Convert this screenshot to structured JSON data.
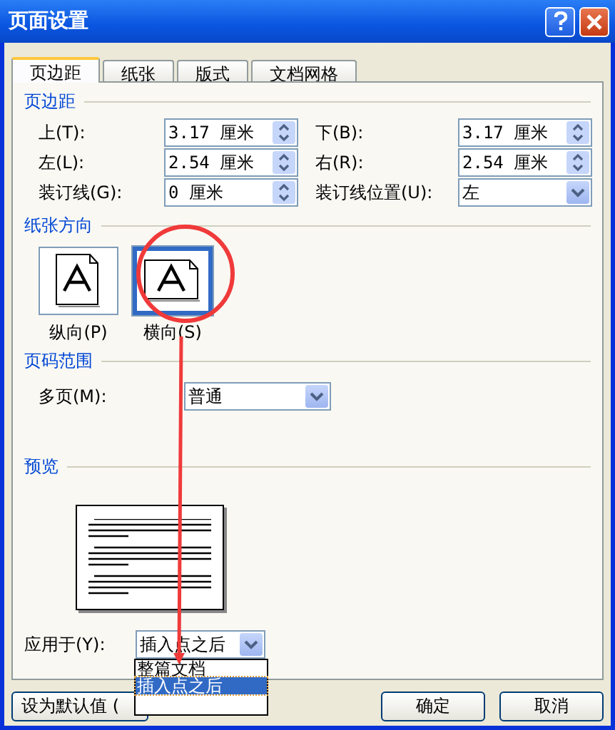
{
  "window": {
    "title": "页面设置"
  },
  "tabs": [
    {
      "label": "页边距",
      "selected": true
    },
    {
      "label": "纸张",
      "selected": false
    },
    {
      "label": "版式",
      "selected": false
    },
    {
      "label": "文档网格",
      "selected": false
    }
  ],
  "margins": {
    "title": "页边距",
    "fields": [
      {
        "label": "上(T):",
        "value": "3.17 厘米",
        "kind": "spinner"
      },
      {
        "label": "下(B):",
        "value": "3.17 厘米",
        "kind": "spinner"
      },
      {
        "label": "左(L):",
        "value": "2.54 厘米",
        "kind": "spinner"
      },
      {
        "label": "右(R):",
        "value": "2.54 厘米",
        "kind": "spinner"
      },
      {
        "label": "装订线(G):",
        "value": "0 厘米",
        "kind": "spinner"
      },
      {
        "label": "装订线位置(U):",
        "value": "左",
        "kind": "select"
      }
    ]
  },
  "orientation": {
    "title": "纸张方向",
    "options": [
      {
        "label": "纵向(P)",
        "kind": "portrait",
        "selected": false
      },
      {
        "label": "横向(S)",
        "kind": "landscape",
        "selected": true
      }
    ]
  },
  "page_range": {
    "title": "页码范围",
    "multiple_pages": {
      "label": "多页(M):",
      "value": "普通"
    }
  },
  "preview": {
    "title": "预览",
    "apply_to": {
      "label": "应用于(Y):",
      "value": "插入点之后",
      "expanded": true,
      "options": [
        {
          "label": "整篇文档",
          "selected": false
        },
        {
          "label": "插入点之后",
          "selected": true
        }
      ]
    }
  },
  "buttons": [
    {
      "label": "设为默认值 (",
      "kind": "default"
    },
    {
      "label": "确定",
      "kind": "ok"
    },
    {
      "label": "取消",
      "kind": "cancel"
    }
  ]
}
